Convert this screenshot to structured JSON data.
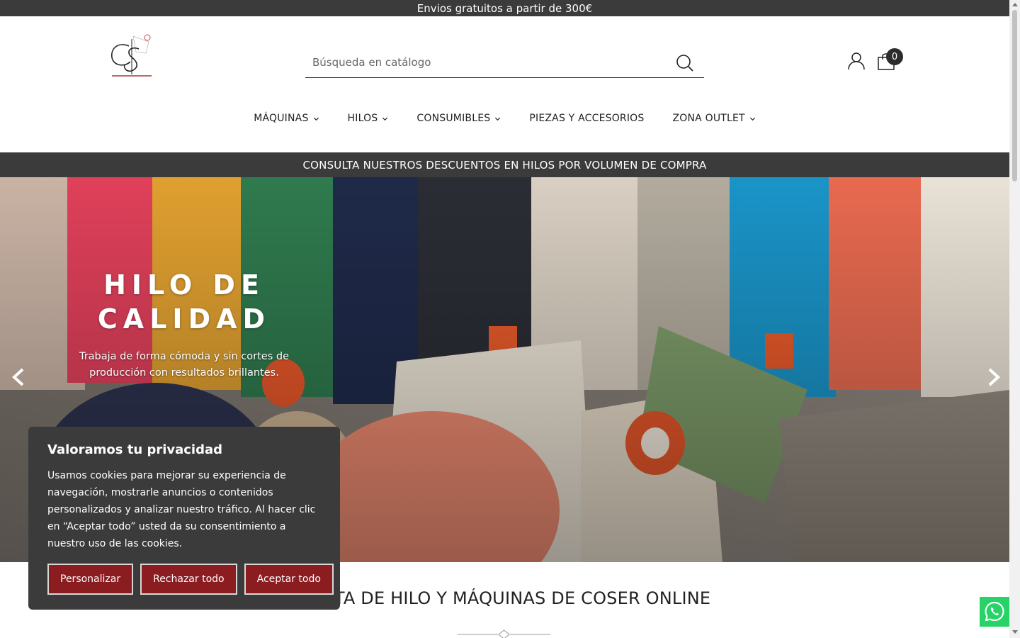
{
  "topbar": {
    "text": "Envios gratuitos a partir de 300€"
  },
  "search": {
    "placeholder": "Búsqueda en catálogo"
  },
  "cart": {
    "count": "0"
  },
  "nav": {
    "items": [
      {
        "label": "MÁQUINAS",
        "has_dropdown": true
      },
      {
        "label": "HILOS",
        "has_dropdown": true
      },
      {
        "label": "CONSUMIBLES",
        "has_dropdown": true
      },
      {
        "label": "PIEZAS Y ACCESORIOS",
        "has_dropdown": false
      },
      {
        "label": "ZONA OUTLET",
        "has_dropdown": true
      }
    ]
  },
  "promo": {
    "text": "CONSULTA NUESTROS DESCUENTOS EN HILOS POR VOLUMEN DE COMPRA"
  },
  "hero": {
    "title": "HILO DE CALIDAD",
    "subtitle": "Trabaja de forma cómoda y sin cortes de producción con resultados brillantes."
  },
  "section": {
    "title": "VENTA DE HILO Y MÁQUINAS DE COSER ONLINE"
  },
  "cookie": {
    "title": "Valoramos tu privacidad",
    "body": "Usamos cookies para mejorar su experiencia de navegación, mostrarle anuncios o contenidos personalizados y analizar nuestro tráfico. Al hacer clic en “Aceptar todo” usted da su consentimiento a nuestro uso de las cookies.",
    "customize": "Personalizar",
    "reject": "Rechazar todo",
    "accept": "Aceptar todo"
  },
  "colors": {
    "dark": "#3b3b3b",
    "button": "#8b1c20",
    "whatsapp": "#25d366"
  },
  "icons": [
    "logo",
    "search-icon",
    "user-icon",
    "shopping-bag-icon",
    "chevron-down-icon",
    "chevron-left-icon",
    "chevron-right-icon",
    "whatsapp-icon"
  ]
}
